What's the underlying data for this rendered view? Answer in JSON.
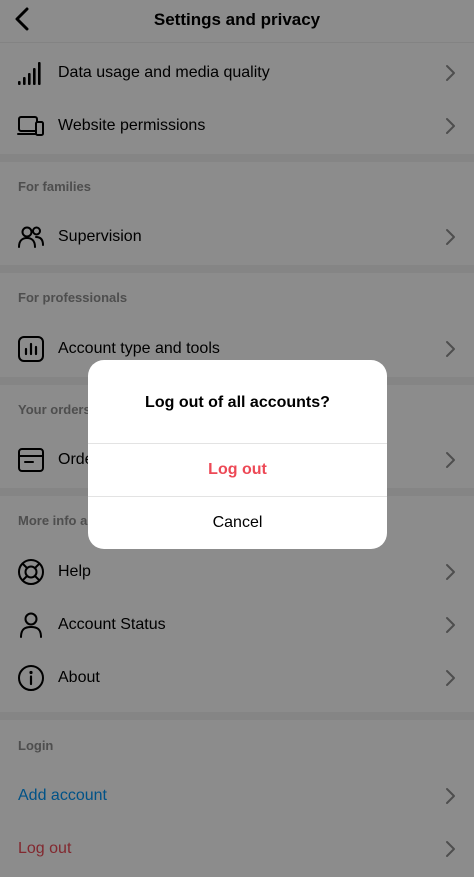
{
  "header": {
    "title": "Settings and privacy"
  },
  "rows": {
    "data_usage": {
      "label": "Data usage and media quality",
      "icon": "signal-bars-icon"
    },
    "website_permissions": {
      "label": "Website permissions",
      "icon": "devices-icon"
    },
    "supervision": {
      "label": "Supervision",
      "icon": "people-icon"
    },
    "account_type": {
      "label": "Account type and tools",
      "icon": "chart-box-icon"
    },
    "orders": {
      "label": "Orders and payments",
      "icon": "order-box-icon"
    },
    "help": {
      "label": "Help",
      "icon": "lifebuoy-icon"
    },
    "account_status": {
      "label": "Account Status",
      "icon": "person-icon"
    },
    "about": {
      "label": "About",
      "icon": "info-icon"
    },
    "add_account": {
      "label": "Add account"
    },
    "log_out": {
      "label": "Log out"
    }
  },
  "sections": {
    "families": "For families",
    "professionals": "For professionals",
    "orders": "Your orders and fundraisers",
    "more_info": "More info and support",
    "login": "Login"
  },
  "dialog": {
    "title": "Log out of all accounts?",
    "confirm_label": "Log out",
    "cancel_label": "Cancel"
  },
  "colors": {
    "link_blue": "#0095f6",
    "danger_red": "#ed4956",
    "section_gray": "#8e8e8e"
  }
}
